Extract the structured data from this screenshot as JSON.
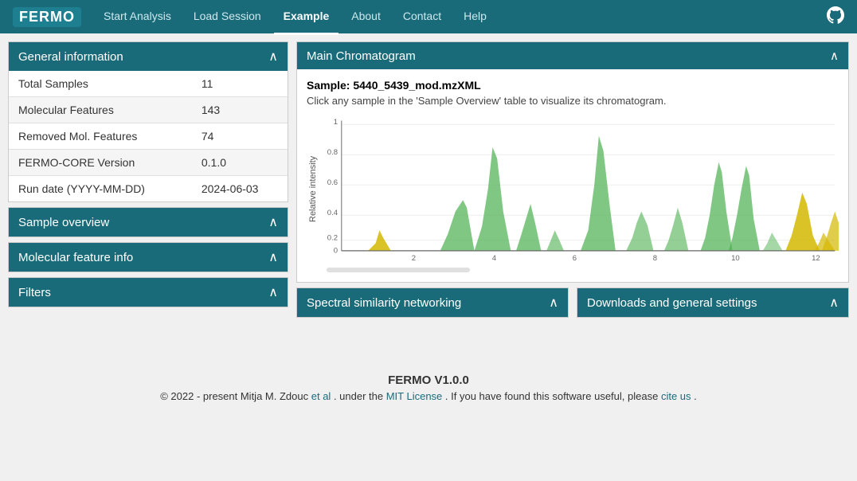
{
  "nav": {
    "logo": "FERMO",
    "links": [
      {
        "label": "Start Analysis",
        "active": false
      },
      {
        "label": "Load Session",
        "active": false
      },
      {
        "label": "Example",
        "active": true
      },
      {
        "label": "About",
        "active": false
      },
      {
        "label": "Contact",
        "active": false
      },
      {
        "label": "Help",
        "active": false
      }
    ],
    "github_icon": "⌥"
  },
  "general_info": {
    "title": "General information",
    "rows": [
      {
        "label": "Total Samples",
        "value": "11"
      },
      {
        "label": "Molecular Features",
        "value": "143"
      },
      {
        "label": "Removed Mol. Features",
        "value": "74"
      },
      {
        "label": "FERMO-CORE Version",
        "value": "0.1.0"
      },
      {
        "label": "Run date (YYYY-MM-DD)",
        "value": "2024-06-03"
      }
    ]
  },
  "sample_overview": {
    "title": "Sample overview"
  },
  "molecular_feature": {
    "title": "Molecular feature info"
  },
  "filters": {
    "title": "Filters"
  },
  "chromatogram": {
    "title": "Main Chromatogram",
    "sample_label": "Sample: 5440_5439_mod.mzXML",
    "description": "Click any sample in the 'Sample Overview' table to visualize its chromatogram.",
    "x_labels": [
      "2",
      "4",
      "6",
      "8",
      "10",
      "12"
    ],
    "y_labels": [
      "0",
      "0.2",
      "0.4",
      "0.6",
      "0.8",
      "1"
    ],
    "y_axis_label": "Relative intensity"
  },
  "spectral": {
    "title": "Spectral similarity networking"
  },
  "downloads": {
    "title": "Downloads and general settings"
  },
  "footer": {
    "title": "FERMO V1.0.0",
    "copyright": "© 2022 - present Mitja M. Zdouc",
    "et_al": "et al",
    "under": ". under the",
    "license_text": "MIT License",
    "found": ". If you have found this software useful, please",
    "cite": "cite us",
    "period": "."
  }
}
